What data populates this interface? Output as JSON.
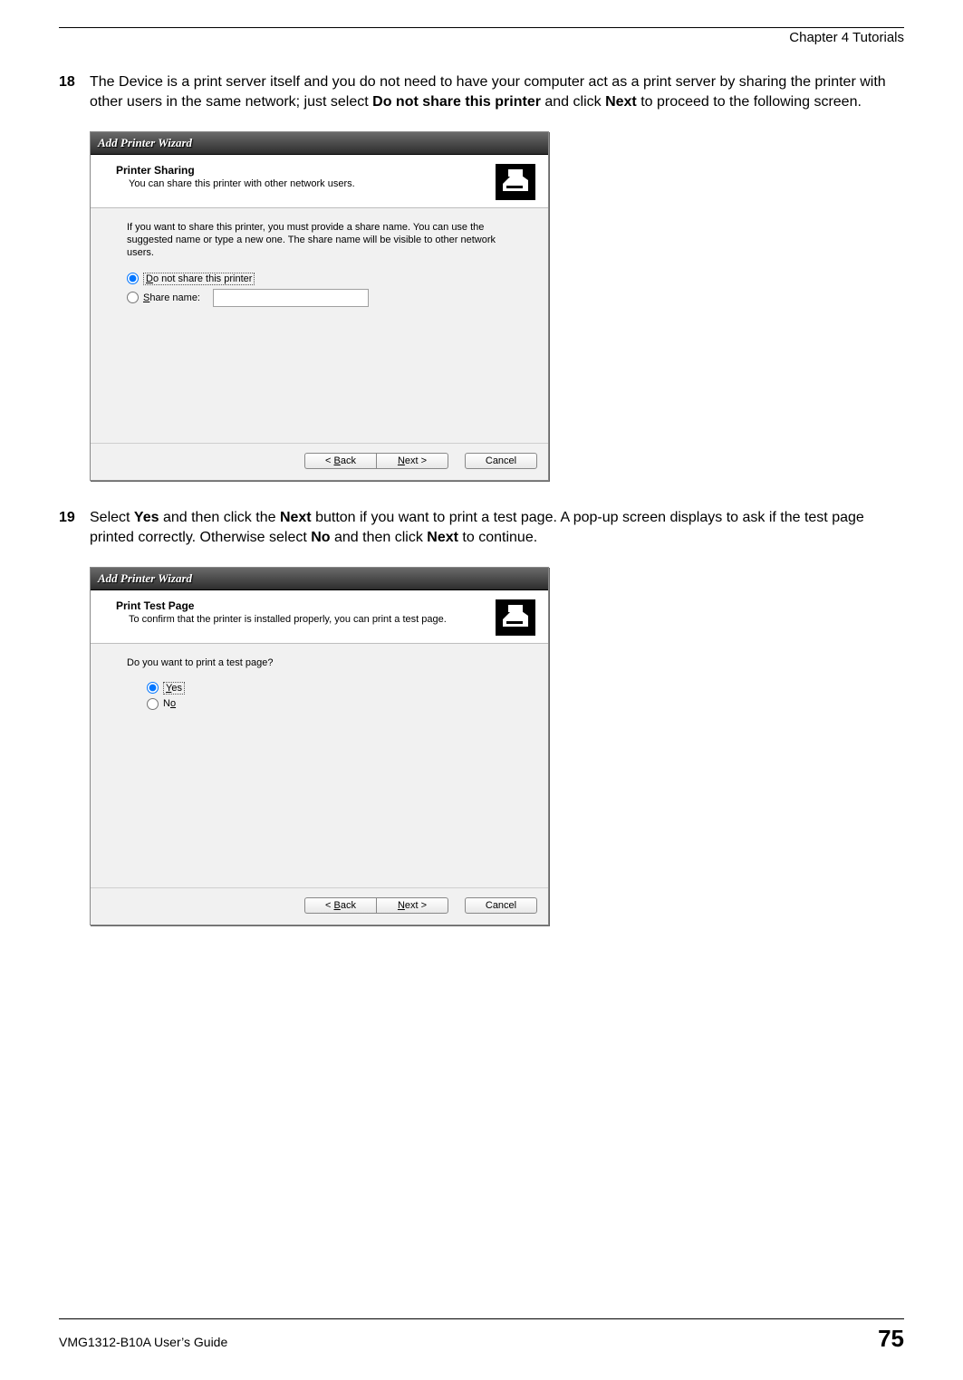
{
  "chapter": "Chapter 4 Tutorials",
  "step18": {
    "num": "18",
    "text_pre": "The Device is a print server itself and you do not need to have your computer act as a print server by sharing the printer with other users in the same network; just select ",
    "bold1": "Do not share this printer",
    "text_mid": " and click ",
    "bold2": "Next",
    "text_post": " to proceed to the following screen."
  },
  "wizard1": {
    "title": "Add Printer Wizard",
    "header_title": "Printer Sharing",
    "header_sub": "You can share this printer with other network users.",
    "body_text": "If you want to share this printer, you must provide a share name. You can use the suggested name or type a new one. The share name will be visible to other network users.",
    "opt_no_share_pre": "D",
    "opt_no_share_post": "o not share this printer",
    "opt_share_pre": "S",
    "opt_share_post": "hare name:",
    "back_pre": "< ",
    "back_u": "B",
    "back_post": "ack",
    "next_u": "N",
    "next_post": "ext >",
    "cancel": "Cancel"
  },
  "step19": {
    "num": "19",
    "text_1": "Select ",
    "bold1": "Yes",
    "text_2": " and then click the ",
    "bold2": "Next",
    "text_3": " button if you want to print a test page. A pop-up screen displays to ask if the test page printed correctly. Otherwise select ",
    "bold3": "No",
    "text_4": " and then click ",
    "bold4": "Next",
    "text_5": " to continue."
  },
  "wizard2": {
    "title": "Add Printer Wizard",
    "header_title": "Print Test Page",
    "header_sub": "To confirm that the printer is installed properly, you can print a test page.",
    "question": "Do you want to print a test page?",
    "opt_yes_u": "Y",
    "opt_yes_post": "es",
    "opt_no_pre": "N",
    "opt_no_u": "o",
    "back_pre": "< ",
    "back_u": "B",
    "back_post": "ack",
    "next_u": "N",
    "next_post": "ext >",
    "cancel": "Cancel"
  },
  "footer_guide": "VMG1312-B10A User’s Guide",
  "page_number": "75"
}
